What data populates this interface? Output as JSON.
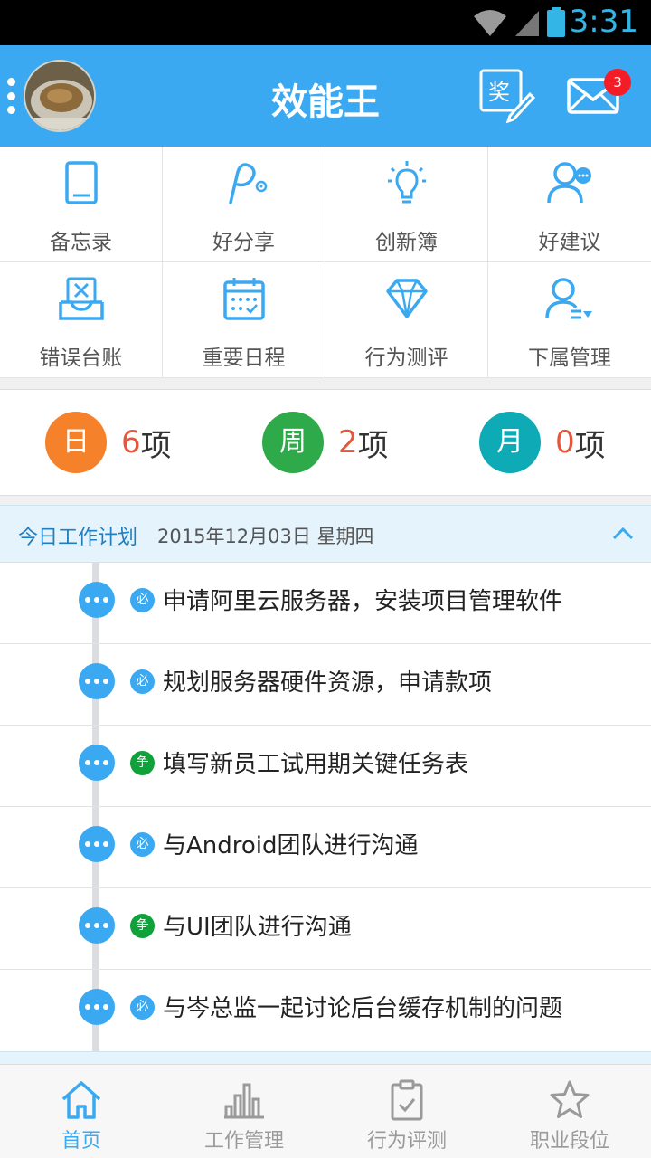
{
  "status_bar": {
    "time": "3:31"
  },
  "header": {
    "title": "效能王",
    "award_icon_char": "奖",
    "mail_badge": "3"
  },
  "grid": [
    {
      "label": "备忘录",
      "icon": "memo-icon"
    },
    {
      "label": "好分享",
      "icon": "share-icon"
    },
    {
      "label": "创新簿",
      "icon": "lightbulb-icon"
    },
    {
      "label": "好建议",
      "icon": "suggestion-icon"
    },
    {
      "label": "错误台账",
      "icon": "error-ledger-icon"
    },
    {
      "label": "重要日程",
      "icon": "calendar-icon"
    },
    {
      "label": "行为测评",
      "icon": "diamond-icon"
    },
    {
      "label": "下属管理",
      "icon": "subordinate-icon"
    }
  ],
  "counters": [
    {
      "circle": "日",
      "count": "6",
      "unit": "项",
      "color": "#f5812a"
    },
    {
      "circle": "周",
      "count": "2",
      "unit": "项",
      "color": "#2eaa4a"
    },
    {
      "circle": "月",
      "count": "0",
      "unit": "项",
      "color": "#0eaab5"
    }
  ],
  "plan": {
    "title": "今日工作计划",
    "date": "2015年12月03日 星期四"
  },
  "tasks": [
    {
      "tag": "必",
      "type": "must",
      "text": "申请阿里云服务器，安装项目管理软件"
    },
    {
      "tag": "必",
      "type": "must",
      "text": "规划服务器硬件资源，申请款项"
    },
    {
      "tag": "争",
      "type": "strive",
      "text": "填写新员工试用期关键任务表"
    },
    {
      "tag": "必",
      "type": "must",
      "text": "与Android团队进行沟通"
    },
    {
      "tag": "争",
      "type": "strive",
      "text": "与UI团队进行沟通"
    },
    {
      "tag": "必",
      "type": "must",
      "text": "与岑总监一起讨论后台缓存机制的问题"
    }
  ],
  "bottom_nav": [
    {
      "label": "首页",
      "icon": "home-icon",
      "active": true
    },
    {
      "label": "工作管理",
      "icon": "bar-chart-icon",
      "active": false
    },
    {
      "label": "行为评测",
      "icon": "clipboard-icon",
      "active": false
    },
    {
      "label": "职业段位",
      "icon": "star-icon",
      "active": false
    }
  ],
  "colors": {
    "primary": "#3aa9f1",
    "must": "#3aa9f1",
    "strive": "#10a13a",
    "count_red": "#e5563b"
  }
}
